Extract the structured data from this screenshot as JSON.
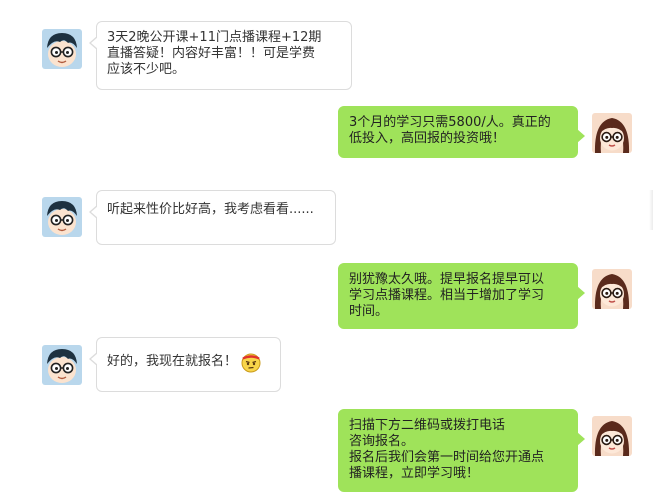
{
  "colors": {
    "incoming_bubble": "#ffffff",
    "incoming_border": "#dcdcdc",
    "outgoing_bubble": "#9fe35a"
  },
  "messages": [
    {
      "side": "left",
      "avatar": "boy-glasses-avatar",
      "lines": [
        "3天2晚公开课+11门点播课程+12期",
        "直播答疑！内容好丰富！！可是学费",
        "应该不少吧。"
      ]
    },
    {
      "side": "right",
      "avatar": "girl-glasses-avatar",
      "lines": [
        "3个月的学习只需5800/人。真正的",
        "低投入，高回报的投资哦！"
      ]
    },
    {
      "side": "left",
      "avatar": "boy-glasses-avatar",
      "lines": [
        "听起来性价比好高，我考虑看看......"
      ]
    },
    {
      "side": "right",
      "avatar": "girl-glasses-avatar",
      "lines": [
        "别犹豫太久哦。提早报名提早可以",
        "学习点播课程。相当于增加了学习",
        "时间。"
      ]
    },
    {
      "side": "left",
      "avatar": "boy-glasses-avatar",
      "lines": [
        "好的，我现在就报名！"
      ],
      "emoji": "determined-face-emoji"
    },
    {
      "side": "right",
      "avatar": "girl-glasses-avatar",
      "lines": [
        "扫描下方二维码或拨打电话",
        "咨询报名。",
        "报名后我们会第一时间给您开通点",
        "播课程，立即学习哦！"
      ]
    }
  ]
}
